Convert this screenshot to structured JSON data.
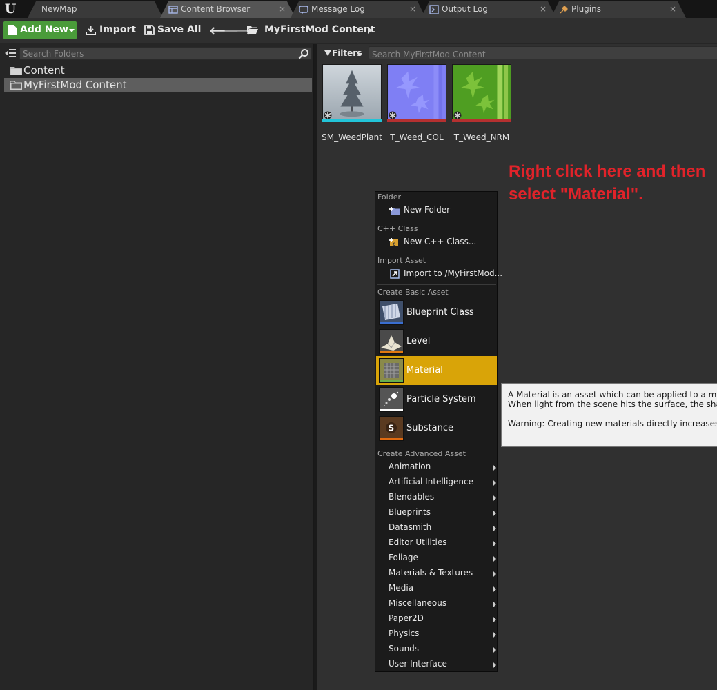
{
  "tabs": [
    {
      "label": "NewMap",
      "closable": false,
      "active": false,
      "icon": "none"
    },
    {
      "label": "Content Browser",
      "closable": true,
      "active": true,
      "icon": "content-browser-icon"
    },
    {
      "label": "Message Log",
      "closable": true,
      "active": false,
      "icon": "message-log-icon"
    },
    {
      "label": "Output Log",
      "closable": true,
      "active": false,
      "icon": "output-log-icon"
    },
    {
      "label": "Plugins",
      "closable": true,
      "active": false,
      "icon": "plugins-icon"
    }
  ],
  "tab_close_glyph": "×",
  "toolbar": {
    "add_new": "Add New",
    "import": "Import",
    "save_all": "Save All",
    "back_glyph": "🡐",
    "forward_glyph": "🡒",
    "path": "MyFirstMod Content"
  },
  "folders_panel": {
    "search_placeholder": "Search Folders",
    "items": [
      {
        "label": "Content",
        "selected": false
      },
      {
        "label": "MyFirstMod Content",
        "selected": true
      }
    ]
  },
  "content_panel": {
    "filters_label": "Filters",
    "search_placeholder": "Search MyFirstMod Content",
    "assets": [
      {
        "name": "SM_WeedPlant",
        "bar_color": "#22c4d8"
      },
      {
        "name": "T_Weed_COL",
        "bar_color": "#b53030"
      },
      {
        "name": "T_Weed_NRM",
        "bar_color": "#b53030"
      }
    ]
  },
  "instruction": {
    "line1": "Right click here and then",
    "line2": "select \"Material\"."
  },
  "context_menu": {
    "folder_header": "Folder",
    "new_folder": "New Folder",
    "cpp_header": "C++ Class",
    "new_cpp_class": "New C++ Class...",
    "import_header": "Import Asset",
    "import_to": "Import to /MyFirstMod...",
    "basic_header": "Create Basic Asset",
    "basic_items": [
      {
        "label": "Blueprint Class",
        "bar_color": "#3a6ed0"
      },
      {
        "label": "Level",
        "bar_color": "#e07a10"
      },
      {
        "label": "Material",
        "bar_color": "#6ab04c"
      },
      {
        "label": "Particle System",
        "bar_color": "#ffffff"
      },
      {
        "label": "Substance",
        "bar_color": "#e06a10"
      }
    ],
    "highlighted": "Material",
    "advanced_header": "Create Advanced Asset",
    "advanced_items": [
      "Animation",
      "Artificial Intelligence",
      "Blendables",
      "Blueprints",
      "Datasmith",
      "Editor Utilities",
      "Foliage",
      "Materials & Textures",
      "Media",
      "Miscellaneous",
      "Paper2D",
      "Physics",
      "Sounds",
      "User Interface"
    ]
  },
  "tooltip": {
    "line1": "A Material is an asset which can be applied to a mesh to",
    "line2": "When light from the scene hits the surface, the shading m",
    "line3": "Warning: Creating new materials directly increases shade"
  },
  "colors": {
    "add_new_green": "#4a9b3a",
    "highlight": "#d9a408",
    "hint_red": "#e0232a"
  }
}
